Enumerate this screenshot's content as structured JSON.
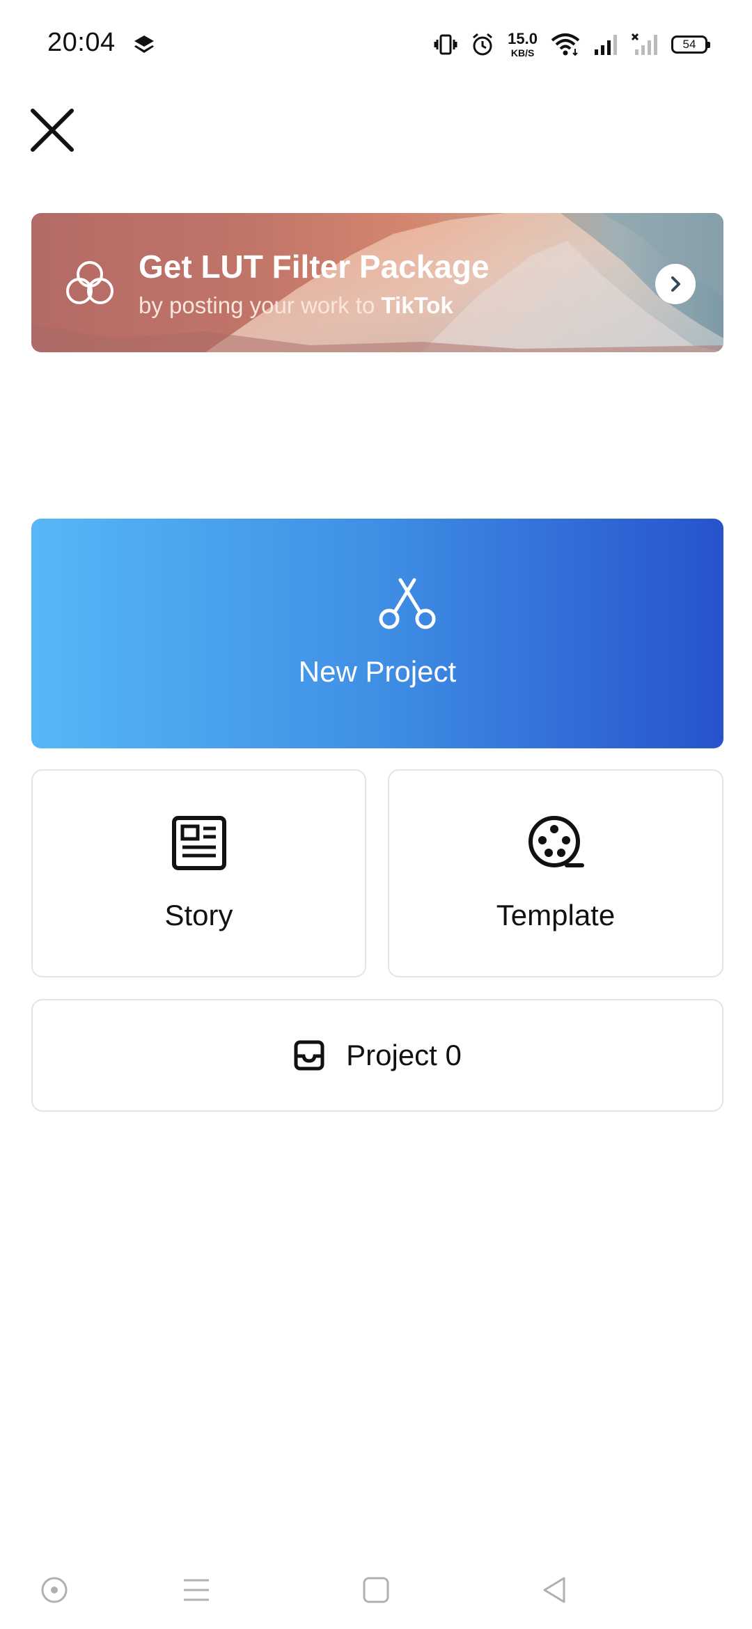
{
  "status_bar": {
    "time": "20:04",
    "net_speed_value": "15.0",
    "net_speed_unit": "KB/S",
    "battery": "54",
    "icons": [
      "stack-icon",
      "vibrate-icon",
      "alarm-icon",
      "wifi-icon",
      "signal-icon",
      "signal-no-sim-icon",
      "battery-icon"
    ]
  },
  "header": {
    "close_icon": "close-icon"
  },
  "banner": {
    "title": "Get LUT Filter Package",
    "subtitle_prefix": "by posting your work to ",
    "subtitle_brand": "TikTok",
    "logo_icon": "three-circles-icon",
    "arrow_icon": "chevron-right-icon"
  },
  "new_project": {
    "label": "New Project",
    "icon": "scissors-icon"
  },
  "story": {
    "label": "Story",
    "icon": "newspaper-icon"
  },
  "template": {
    "label": "Template",
    "icon": "film-reel-icon"
  },
  "projects": {
    "label": "Project 0",
    "icon": "inbox-icon"
  },
  "nav_bar": {
    "icons": [
      "assistant-icon",
      "menu-icon",
      "home-icon",
      "back-icon"
    ]
  },
  "colors": {
    "new_project_gradient_start": "#56b7f7",
    "new_project_gradient_end": "#2753cc",
    "card_border": "#e4e4e4",
    "banner_start": "#b46a66"
  }
}
